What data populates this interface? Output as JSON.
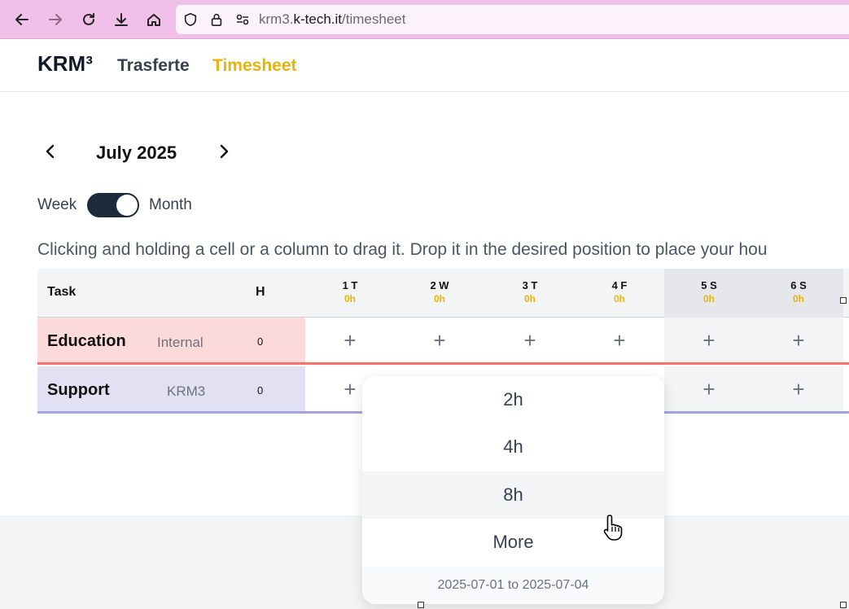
{
  "browser": {
    "url_prefix": "krm3.",
    "url_host": "k-tech.it",
    "url_path": "/timesheet"
  },
  "app": {
    "logo": "KRM³",
    "nav": [
      {
        "label": "Trasferte",
        "color": "#374151"
      },
      {
        "label": "Timesheet",
        "color": "#eab308"
      }
    ]
  },
  "calendar": {
    "month": "July 2025",
    "toggle_left": "Week",
    "toggle_right": "Month"
  },
  "instructions": "Clicking and holding a cell or a column to drag it. Drop it in the desired position to place your hou",
  "table": {
    "task_header": "Task",
    "hours_header": "H",
    "days": [
      {
        "label": "1 T",
        "hours": "0h",
        "weekend": false
      },
      {
        "label": "2 W",
        "hours": "0h",
        "weekend": false
      },
      {
        "label": "3 T",
        "hours": "0h",
        "weekend": false
      },
      {
        "label": "4 F",
        "hours": "0h",
        "weekend": false
      },
      {
        "label": "5 S",
        "hours": "0h",
        "weekend": true
      },
      {
        "label": "6 S",
        "hours": "0h",
        "weekend": true
      }
    ],
    "rows": [
      {
        "name": "Education",
        "category": "Internal",
        "hours": "0",
        "bg": "#fddada",
        "line": "#f87171"
      },
      {
        "name": "Support",
        "category": "KRM3",
        "hours": "0",
        "bg": "#e2e1f3",
        "line": "#a5a3d8"
      }
    ],
    "add_symbol": "+"
  },
  "dropdown": {
    "options": [
      "2h",
      "4h",
      "8h",
      "More"
    ],
    "highlighted": "8h",
    "range": "2025-07-01 to 2025-07-04"
  }
}
